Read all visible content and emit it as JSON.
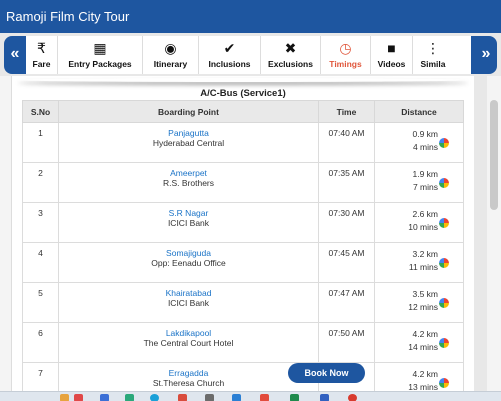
{
  "app": {
    "title": "Ramoji Film City Tour"
  },
  "nav": {
    "prev_arrow": "«",
    "next_arrow": "»",
    "tabs": [
      {
        "label": "Fare",
        "icon": "rupee-icon",
        "glyph": "₹",
        "active": false
      },
      {
        "label": "Entry Packages",
        "icon": "grid-icon",
        "glyph": "▦",
        "active": false
      },
      {
        "label": "Itinerary",
        "icon": "eye-icon",
        "glyph": "◉",
        "active": false
      },
      {
        "label": "Inclusions",
        "icon": "check-icon",
        "glyph": "✔",
        "active": false
      },
      {
        "label": "Exclusions",
        "icon": "cross-icon",
        "glyph": "✖",
        "active": false
      },
      {
        "label": "Timings",
        "icon": "clock-icon",
        "glyph": "◷",
        "active": true
      },
      {
        "label": "Videos",
        "icon": "video-camera-icon",
        "glyph": "■",
        "active": false
      },
      {
        "label": "Simila",
        "icon": "more-vertical-icon",
        "glyph": "⋮",
        "active": false
      }
    ]
  },
  "bus": {
    "title": "A/C-Bus (Service1)"
  },
  "table": {
    "headers": {
      "sno": "S.No",
      "boarding": "Boarding Point",
      "time": "Time",
      "distance": "Distance"
    },
    "rows": [
      {
        "sno": "1",
        "stop": "Panjagutta",
        "address": "Hyderabad Central",
        "time": "07:40 AM",
        "distance": "0.9 km",
        "duration": "4 mins"
      },
      {
        "sno": "2",
        "stop": "Ameerpet",
        "address": "R.S. Brothers",
        "time": "07:35 AM",
        "distance": "1.9 km",
        "duration": "7 mins"
      },
      {
        "sno": "3",
        "stop": "S.R Nagar",
        "address": "ICICI Bank",
        "time": "07:30 AM",
        "distance": "2.6 km",
        "duration": "10 mins"
      },
      {
        "sno": "4",
        "stop": "Somajiguda",
        "address": "Opp: Eenadu Office",
        "time": "07:45 AM",
        "distance": "3.2 km",
        "duration": "11 mins"
      },
      {
        "sno": "5",
        "stop": "Khairatabad",
        "address": "ICICI Bank",
        "time": "07:47 AM",
        "distance": "3.5 km",
        "duration": "12 mins"
      },
      {
        "sno": "6",
        "stop": "Lakdikapool",
        "address": "The Central Court Hotel",
        "time": "07:50 AM",
        "distance": "4.2 km",
        "duration": "14 mins"
      },
      {
        "sno": "7",
        "stop": "Erragadda",
        "address": "St.Theresa Church",
        "time": "",
        "distance": "4.2 km",
        "duration": "13 mins"
      }
    ]
  },
  "actions": {
    "book_now": "Book Now"
  },
  "colors": {
    "brand": "#1e56a0",
    "active_tab": "#e0563b",
    "link": "#1a73c7"
  }
}
